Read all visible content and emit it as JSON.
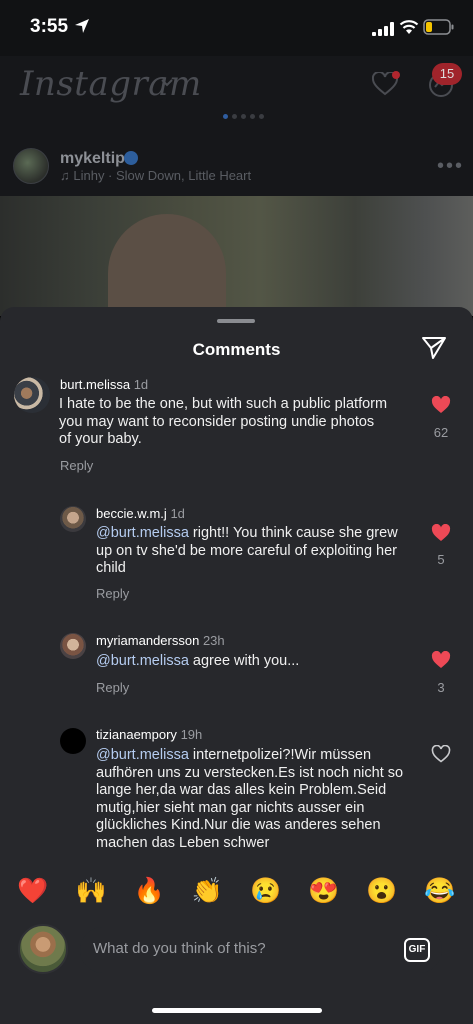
{
  "status_bar": {
    "time": "3:55"
  },
  "feed": {
    "logo": "Instagram",
    "messages_badge": "15",
    "post": {
      "username": "mykeltip",
      "music": "♫ Linhy · Slow Down, Little Heart"
    }
  },
  "sheet": {
    "title": "Comments",
    "comments": [
      {
        "username": "burt.melissa",
        "time": "1d",
        "text": "I hate to be the one, but with such a public platform you may want to reconsider posting undie photos of your baby.",
        "reply": "Reply",
        "likes": "62"
      },
      {
        "username": "beccie.w.m.j",
        "time": "1d",
        "mention": "@burt.melissa",
        "text": " right!! You think cause she grew up on tv she'd be more careful of exploiting her child",
        "reply": "Reply",
        "likes": "5"
      },
      {
        "username": "myriamandersson",
        "time": "23h",
        "mention": "@burt.melissa",
        "text": " agree with you...",
        "reply": "Reply",
        "likes": "3"
      },
      {
        "username": "tizianaempory",
        "time": "19h",
        "mention": "@burt.melissa",
        "text": " internetpolizei?!Wir müssen aufhören uns zu verstecken.Es ist noch nicht so lange her,da war das alles kein Problem.Seid mutig,hier sieht man gar nichts ausser ein glückliches Kind.Nur die was anderes sehen machen das Leben schwer"
      }
    ],
    "emojis": [
      "❤️",
      "🙌",
      "🔥",
      "👏",
      "😢",
      "😍",
      "😮",
      "😂"
    ],
    "composer": {
      "placeholder": "What do you think of this?",
      "gif_label": "GIF"
    }
  },
  "colors": {
    "sheet_bg": "#27282c",
    "like_red": "#ed4956",
    "mention_blue": "#b5ccf0",
    "muted_text": "#9a9ca1"
  }
}
